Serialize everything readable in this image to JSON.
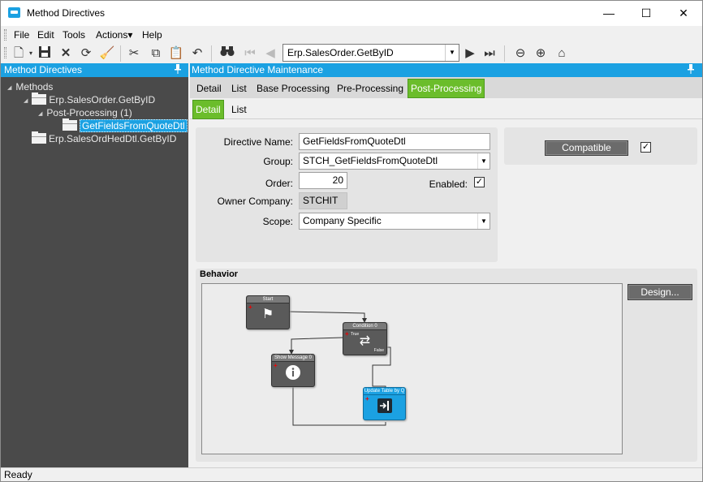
{
  "window": {
    "title": "Method Directives",
    "minimize": "—",
    "maximize": "☐",
    "close": "✕"
  },
  "menu": [
    "File",
    "Edit",
    "Tools",
    "Actions▾",
    "Help"
  ],
  "toolbar": {
    "method_value": "Erp.SalesOrder.GetByID"
  },
  "left_pane": {
    "title": "Method Directives",
    "pin": "📌",
    "tree": {
      "root": "Methods",
      "node1": "Erp.SalesOrder.GetByID",
      "group": "Post-Processing (1)",
      "leaf": "GetFieldsFromQuoteDtl",
      "node2": "Erp.SalesOrdHedDtl.GetByID"
    }
  },
  "right_pane": {
    "title": "Method Directive Maintenance",
    "tabs": [
      "Detail",
      "List",
      "Base Processing",
      "Pre-Processing",
      "Post-Processing"
    ],
    "subtabs": [
      "Detail",
      "List"
    ],
    "form": {
      "directive_name_label": "Directive Name:",
      "directive_name_value": "GetFieldsFromQuoteDtl",
      "group_label": "Group:",
      "group_value": "STCH_GetFieldsFromQuoteDtl",
      "order_label": "Order:",
      "order_value": "20",
      "enabled_label": "Enabled:",
      "owner_label": "Owner Company:",
      "owner_value": "STCHIT",
      "scope_label": "Scope:",
      "scope_value": "Company Specific",
      "compatible_label": "Compatible"
    },
    "behavior": {
      "label": "Behavior",
      "design_button": "Design...",
      "nodes": {
        "start": "Start",
        "condition": "Condition 0",
        "true_label": "True",
        "false_label": "False",
        "show_message": "Show Message 0",
        "update_table": "Update Table by Q"
      }
    }
  },
  "status": "Ready"
}
